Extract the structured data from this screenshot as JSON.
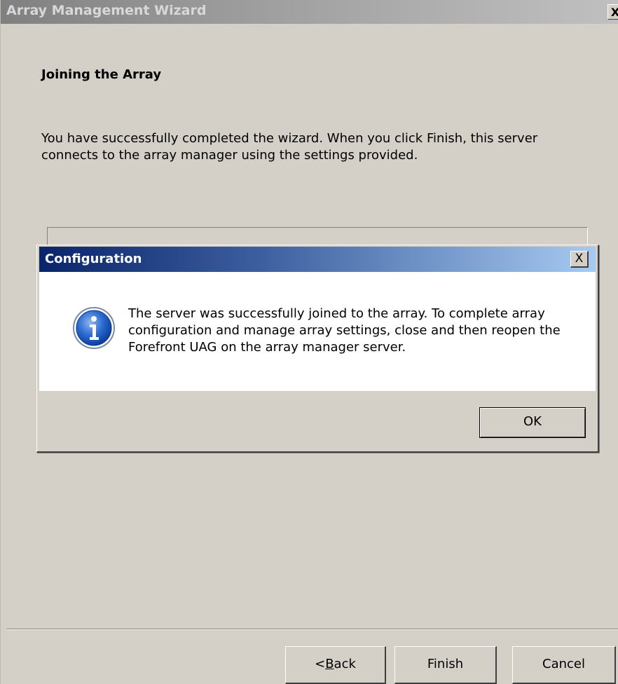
{
  "wizard": {
    "title": "Array Management Wizard",
    "close_label": "X",
    "heading": "Joining the Array",
    "description": "You have successfully completed the wizard. When you click Finish, this server connects to the array manager using the settings provided.",
    "buttons": {
      "back_prefix": "< ",
      "back_mnemonic": "B",
      "back_rest": "ack",
      "finish": "Finish",
      "cancel": "Cancel"
    }
  },
  "dialog": {
    "title": "Configuration",
    "close_label": "X",
    "icon": "info-icon",
    "message": "The server was successfully joined to the array. To complete array configuration and manage array settings, close and then reopen the Forefront UAG on the array manager server.",
    "ok_label": "OK"
  },
  "colors": {
    "dialog_title_start": "#0a246a",
    "dialog_title_end": "#a6caf0",
    "window_face": "#d4d0c8",
    "info_icon_blue": "#1f5fbf"
  }
}
